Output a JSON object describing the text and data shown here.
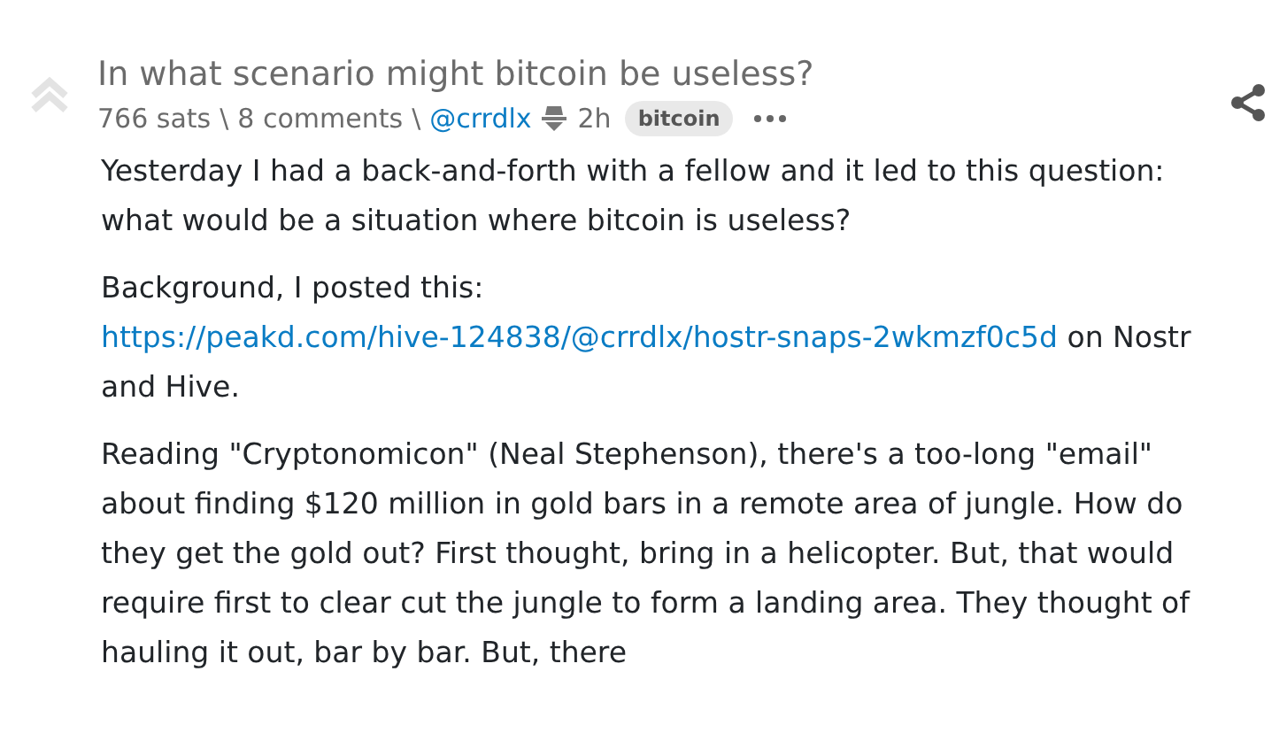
{
  "post": {
    "title": "In what scenario might bitcoin be useless?",
    "upvoted": false,
    "meta": {
      "sats": "766 sats",
      "separator_1": "\\",
      "comments": "8 comments",
      "separator_2": "\\",
      "author": "@crrdlx",
      "age": "2h",
      "tag": "bitcoin"
    },
    "paragraphs": [
      {
        "parts": [
          {
            "kind": "text",
            "text": "Yesterday I had a back-and-forth with a fellow and it led to this question: what would be a situation where bitcoin is useless?"
          }
        ]
      },
      {
        "parts": [
          {
            "kind": "text",
            "text": "Background, I posted this: "
          },
          {
            "kind": "link",
            "text": "https://peakd.com/hive-124838/@crrdlx/hostr-snaps-2wkmzf0c5d"
          },
          {
            "kind": "text",
            "text": " on Nostr and Hive."
          }
        ]
      },
      {
        "parts": [
          {
            "kind": "text",
            "text": "Reading \"Cryptonomicon\" (Neal Stephenson), there's a too-long \"email\" about finding $120 million in gold bars in a remote area of jungle. How do they get the gold out? First thought, bring in a helicopter. But, that would require first to clear cut the jungle to form a landing area. They thought of hauling it out, bar by bar. But, there"
          }
        ]
      }
    ]
  }
}
